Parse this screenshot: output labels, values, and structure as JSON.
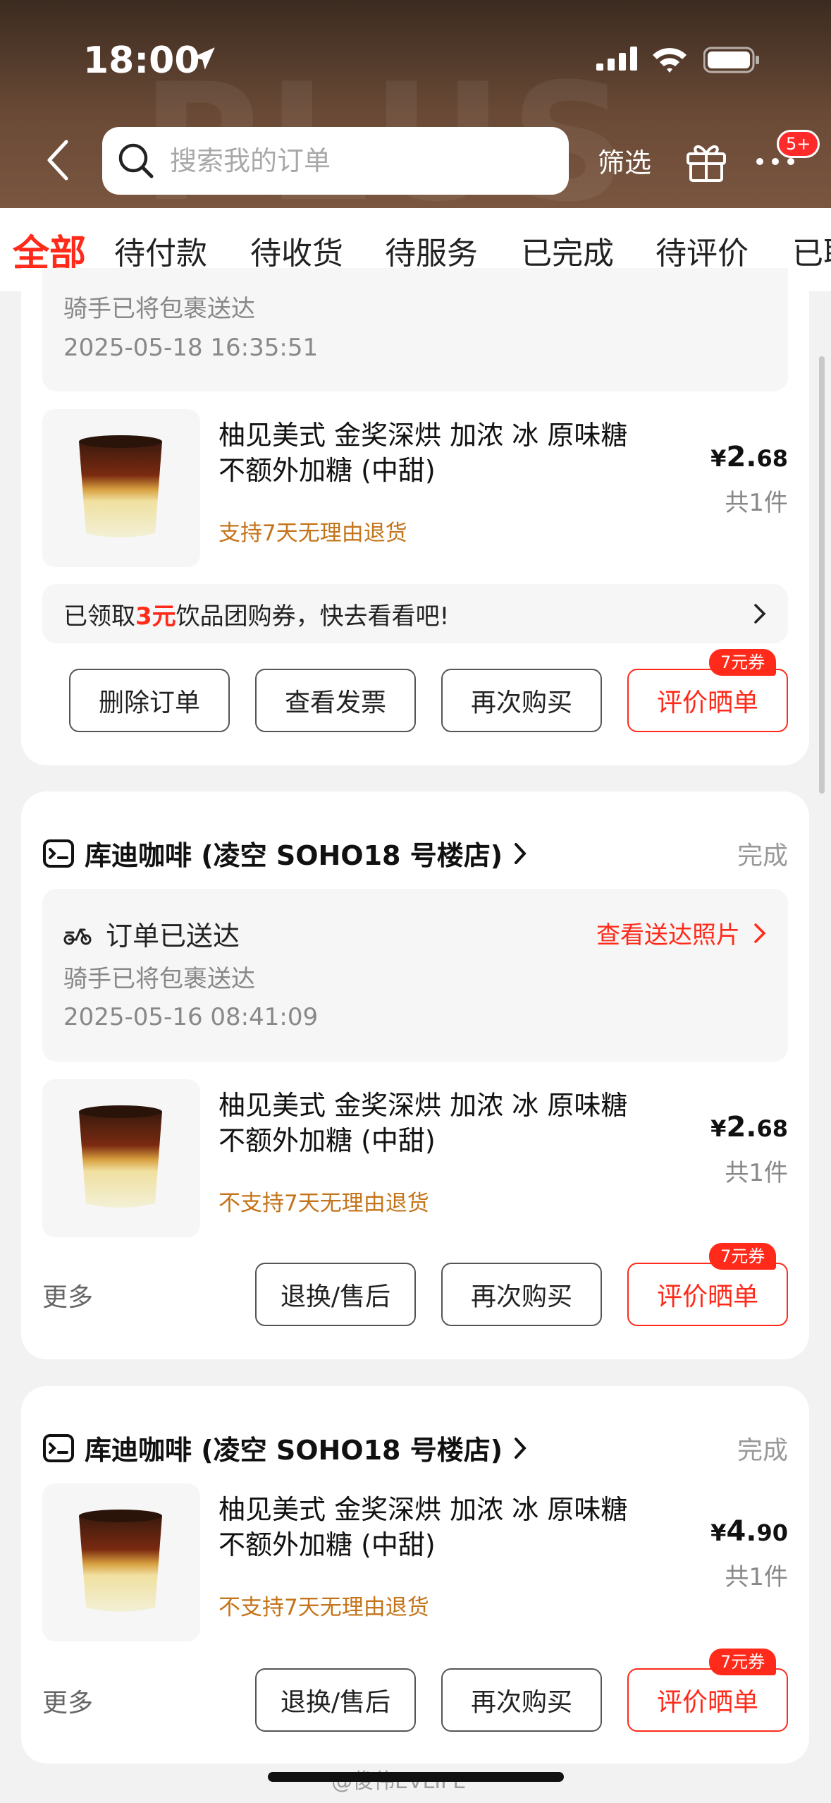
{
  "status_bar": {
    "time": "18:00"
  },
  "header": {
    "watermark": "PLUS",
    "search_placeholder": "搜索我的订单",
    "filter_label": "筛选",
    "badge": "5+"
  },
  "tabs": [
    "全部",
    "待付款",
    "待收货",
    "待服务",
    "已完成",
    "待评价",
    "已取"
  ],
  "order0": {
    "delivery_sub": "骑手已将包裹送达",
    "delivery_time": "2025-05-18 16:35:51",
    "product_line1": "柚见美式 金奖深烘 加浓 冰 原味糖",
    "product_line2": "不额外加糖 (中甜)",
    "note": "支持7天无理由退货",
    "price_yuan": "¥",
    "price_int": "2.",
    "price_dec": "68",
    "qty": "共1件",
    "coupon_pre": "已领取",
    "coupon_amount": "3元",
    "coupon_post": "饮品团购券，快去看看吧!",
    "buttons": [
      "删除订单",
      "查看发票",
      "再次购买",
      "评价晒单"
    ],
    "tag": "7元券"
  },
  "order1": {
    "shop": "库迪咖啡 (凌空 SOHO18 号楼店)",
    "status": "完成",
    "delivery_title": "订单已送达",
    "delivery_link": "查看送达照片",
    "delivery_sub": "骑手已将包裹送达",
    "delivery_time": "2025-05-16 08:41:09",
    "product_line1": "柚见美式 金奖深烘 加浓 冰 原味糖",
    "product_line2": "不额外加糖 (中甜)",
    "note": "不支持7天无理由退货",
    "price_yuan": "¥",
    "price_int": "2.",
    "price_dec": "68",
    "qty": "共1件",
    "more": "更多",
    "buttons": [
      "退换/售后",
      "再次购买",
      "评价晒单"
    ],
    "tag": "7元券"
  },
  "order2": {
    "shop": "库迪咖啡 (凌空 SOHO18 号楼店)",
    "status": "完成",
    "product_line1": "柚见美式 金奖深烘 加浓 冰 原味糖",
    "product_line2": "不额外加糖 (中甜)",
    "note": "不支持7天无理由退货",
    "price_yuan": "¥",
    "price_int": "4.",
    "price_dec": "90",
    "qty": "共1件",
    "more": "更多",
    "buttons": [
      "退换/售后",
      "再次购买",
      "评价晒单"
    ],
    "tag": "7元券"
  },
  "credit": "@俊伟EVLIFE",
  "colors": {
    "accent": "#ff2a1a",
    "header_bg": "#5a4030",
    "note": "#c4741a"
  }
}
